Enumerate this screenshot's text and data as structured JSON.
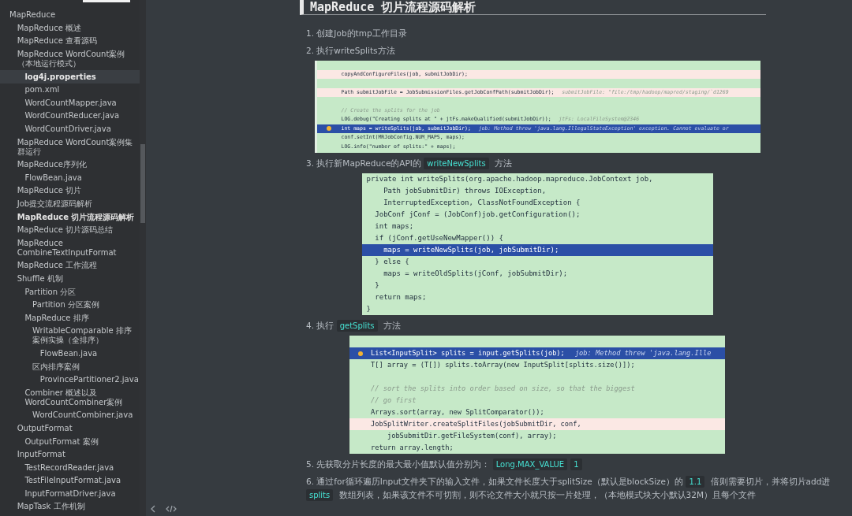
{
  "sidebar": {
    "items": [
      {
        "label": "MapReduce",
        "selected": false,
        "current": false,
        "children": [
          {
            "label": "MapReduce 概述",
            "selected": false,
            "current": false
          },
          {
            "label": "MapReduce 查看源码",
            "selected": false,
            "current": false
          },
          {
            "label": "MapReduce WordCount案例（本地运行模式）",
            "selected": false,
            "current": false,
            "children": [
              {
                "label": "log4j.properties",
                "selected": true,
                "current": false
              },
              {
                "label": "pom.xml",
                "selected": false,
                "current": false
              },
              {
                "label": "WordCountMapper.java",
                "selected": false,
                "current": false
              },
              {
                "label": "WordCountReducer.java",
                "selected": false,
                "current": false
              },
              {
                "label": "WordCountDriver.java",
                "selected": false,
                "current": false
              }
            ]
          },
          {
            "label": "MapReduce WordCount案例集群运行",
            "selected": false,
            "current": false
          },
          {
            "label": "MapReduce序列化",
            "selected": false,
            "current": false,
            "children": [
              {
                "label": "FlowBean.java",
                "selected": false,
                "current": false
              }
            ]
          },
          {
            "label": "MapReduce 切片",
            "selected": false,
            "current": false
          },
          {
            "label": "Job提交流程源码解析",
            "selected": false,
            "current": false
          },
          {
            "label": "MapReduce 切片流程源码解析",
            "selected": false,
            "current": true
          },
          {
            "label": "MapReduce 切片源码总结",
            "selected": false,
            "current": false
          },
          {
            "label": "MapReduce CombineTextInputFormat",
            "selected": false,
            "current": false
          },
          {
            "label": "MapReduce 工作流程",
            "selected": false,
            "current": false
          },
          {
            "label": "Shuffle 机制",
            "selected": false,
            "current": false,
            "children": [
              {
                "label": "Partition 分区",
                "selected": false,
                "current": false,
                "children": [
                  {
                    "label": "Partition 分区案例",
                    "selected": false,
                    "current": false
                  }
                ]
              },
              {
                "label": "MapReduce 排序",
                "selected": false,
                "current": false,
                "children": [
                  {
                    "label": "WritableComparable 排序案例实操（全排序）",
                    "selected": false,
                    "current": false,
                    "children": [
                      {
                        "label": "FlowBean.java",
                        "selected": false,
                        "current": false
                      }
                    ]
                  },
                  {
                    "label": "区内排序案例",
                    "selected": false,
                    "current": false,
                    "children": [
                      {
                        "label": "ProvincePartitioner2.java",
                        "selected": false,
                        "current": false
                      }
                    ]
                  }
                ]
              },
              {
                "label": "Combiner 概述以及WordCountCombiner案例",
                "selected": false,
                "current": false,
                "children": [
                  {
                    "label": "WordCountCombiner.java",
                    "selected": false,
                    "current": false
                  }
                ]
              }
            ]
          },
          {
            "label": "OutputFormat",
            "selected": false,
            "current": false,
            "children": [
              {
                "label": "OutputFormat 案例",
                "selected": false,
                "current": false
              }
            ]
          },
          {
            "label": "InputFormat",
            "selected": false,
            "current": false,
            "children": [
              {
                "label": "TestRecordReader.java",
                "selected": false,
                "current": false
              },
              {
                "label": "TestFileInputFormat.java",
                "selected": false,
                "current": false
              },
              {
                "label": "InputFormatDriver.java",
                "selected": false,
                "current": false
              }
            ]
          },
          {
            "label": "MapTask 工作机制",
            "selected": false,
            "current": false
          }
        ]
      }
    ]
  },
  "article": {
    "title": "MapReduce 切片流程源码解析",
    "blocks": [
      {
        "kind": "step",
        "parts": [
          {
            "kind": "text",
            "text": "1. 创建Job的tmp工作目录"
          }
        ]
      },
      {
        "kind": "step",
        "parts": [
          {
            "kind": "text",
            "text": "2. 执行writeSplits方法"
          }
        ]
      },
      {
        "kind": "code",
        "lines": [
          {
            "kind": "blank",
            "changed": false,
            "current": false,
            "breakpoint": false
          },
          {
            "kind": "code",
            "changed": true,
            "current": false,
            "breakpoint": false,
            "text": "copyAndConfigureFiles(job, submitJobDir);"
          },
          {
            "kind": "blank",
            "changed": false,
            "current": false,
            "breakpoint": false
          },
          {
            "kind": "code",
            "changed": true,
            "current": false,
            "breakpoint": false,
            "text": "Path submitJobFile = JobSubmissionFiles.getJobConfPath(submitJobDir);",
            "hint": "submitJobFile: \"file:/tmp/hadoop/mapred/staging/`d1269"
          },
          {
            "kind": "blank",
            "changed": false,
            "current": false,
            "breakpoint": false
          },
          {
            "kind": "comment",
            "changed": false,
            "current": false,
            "breakpoint": false,
            "text": "// Create the splits for the job"
          },
          {
            "kind": "code",
            "changed": false,
            "current": false,
            "breakpoint": false,
            "text": "LOG.debug(\"Creating splits at \" + jtFs.makeQualified(submitJobDir));",
            "hint": "jtFs: LocalFileSystem@2346"
          },
          {
            "kind": "code",
            "changed": false,
            "current": true,
            "breakpoint": true,
            "text": "int maps = writeSplits(job, submitJobDir);",
            "hint": "job: Method threw 'java.lang.IllegalStateException' exception. Cannot evaluate or"
          },
          {
            "kind": "code",
            "changed": false,
            "current": false,
            "breakpoint": false,
            "text": "conf.setInt(MRJobConfig.NUM_MAPS, maps);"
          },
          {
            "kind": "code",
            "changed": false,
            "current": false,
            "breakpoint": false,
            "text": "LOG.info(\"number of splits:\" + maps);"
          }
        ]
      },
      {
        "kind": "step",
        "parts": [
          {
            "kind": "text",
            "text": "3. 执行新MapReduce的API的 "
          },
          {
            "kind": "code",
            "text": "writeNewSplits"
          },
          {
            "kind": "text",
            "text": " 方法"
          }
        ]
      },
      {
        "kind": "code",
        "lines": [
          {
            "kind": "code",
            "changed": false,
            "current": false,
            "breakpoint": false,
            "text": "private int writeSplits(org.apache.hadoop.mapreduce.JobContext job,"
          },
          {
            "kind": "code",
            "changed": false,
            "current": false,
            "breakpoint": false,
            "text": "    Path jobSubmitDir) throws IOException,"
          },
          {
            "kind": "code",
            "changed": false,
            "current": false,
            "breakpoint": false,
            "text": "    InterruptedException, ClassNotFoundException {"
          },
          {
            "kind": "code",
            "changed": false,
            "current": false,
            "breakpoint": false,
            "text": "  JobConf jConf = (JobConf)job.getConfiguration();"
          },
          {
            "kind": "code",
            "changed": false,
            "current": false,
            "breakpoint": false,
            "text": "  int maps;"
          },
          {
            "kind": "code",
            "changed": false,
            "current": false,
            "breakpoint": false,
            "text": "  if (jConf.getUseNewMapper()) {"
          },
          {
            "kind": "code",
            "changed": false,
            "current": true,
            "breakpoint": false,
            "text": "    maps = writeNewSplits(job, jobSubmitDir);"
          },
          {
            "kind": "code",
            "changed": false,
            "current": false,
            "breakpoint": false,
            "text": "  } else {"
          },
          {
            "kind": "code",
            "changed": false,
            "current": false,
            "breakpoint": false,
            "text": "    maps = writeOldSplits(jConf, jobSubmitDir);"
          },
          {
            "kind": "code",
            "changed": false,
            "current": false,
            "breakpoint": false,
            "text": "  }"
          },
          {
            "kind": "code",
            "changed": false,
            "current": false,
            "breakpoint": false,
            "text": "  return maps;"
          },
          {
            "kind": "code",
            "changed": false,
            "current": false,
            "breakpoint": false,
            "text": "}"
          }
        ]
      },
      {
        "kind": "step",
        "parts": [
          {
            "kind": "text",
            "text": "4. 执行 "
          },
          {
            "kind": "code",
            "text": "getSplits"
          },
          {
            "kind": "text",
            "text": " 方法"
          }
        ]
      },
      {
        "kind": "code",
        "lines": [
          {
            "kind": "blank",
            "changed": false,
            "current": false,
            "breakpoint": false
          },
          {
            "kind": "code",
            "changed": false,
            "current": true,
            "breakpoint": true,
            "text": "List<InputSplit> splits = input.getSplits(job);",
            "hint": "job: Method threw 'java.lang.Ille"
          },
          {
            "kind": "code",
            "changed": false,
            "current": false,
            "breakpoint": false,
            "text": "T[] array = (T[]) splits.toArray(new InputSplit[splits.size()]);"
          },
          {
            "kind": "blank",
            "changed": false,
            "current": false,
            "breakpoint": false
          },
          {
            "kind": "comment",
            "changed": false,
            "current": false,
            "breakpoint": false,
            "text": "// sort the splits into order based on size, so that the biggest"
          },
          {
            "kind": "comment",
            "changed": false,
            "current": false,
            "breakpoint": false,
            "text": "// go first"
          },
          {
            "kind": "code",
            "changed": false,
            "current": false,
            "breakpoint": false,
            "text": "Arrays.sort(array, new SplitComparator());"
          },
          {
            "kind": "code",
            "changed": true,
            "current": false,
            "breakpoint": false,
            "text": "JobSplitWriter.createSplitFiles(jobSubmitDir, conf,"
          },
          {
            "kind": "code",
            "changed": false,
            "current": false,
            "breakpoint": false,
            "text": "    jobSubmitDir.getFileSystem(conf), array);"
          },
          {
            "kind": "code",
            "changed": false,
            "current": false,
            "breakpoint": false,
            "text": "return array.length;"
          }
        ]
      },
      {
        "kind": "step",
        "parts": [
          {
            "kind": "text",
            "text": "5. 先获取分片长度的最大最小值默认值分别为： "
          },
          {
            "kind": "code",
            "text": "Long.MAX_VALUE"
          },
          {
            "kind": "code",
            "text": "1"
          }
        ]
      },
      {
        "kind": "step",
        "parts": [
          {
            "kind": "text",
            "text": "6. 通过for循环遍历Input文件夹下的输入文件，如果文件长度大于splitSize（默认是blockSize）的 "
          },
          {
            "kind": "code",
            "text": "1.1"
          },
          {
            "kind": "text",
            "text": " 倍则需要切片，并将切片add进 "
          },
          {
            "kind": "code",
            "text": "splits"
          },
          {
            "kind": "text",
            "text": " 数组列表，如果该文件不可切割，则不论文件大小就只按一片处理，（本地模式块大小默认32M）且每个文件"
          }
        ]
      }
    ]
  }
}
